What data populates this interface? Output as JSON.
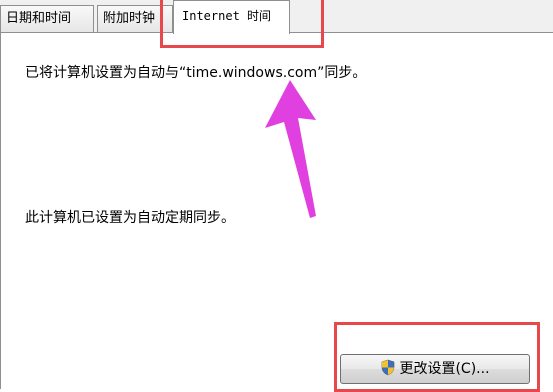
{
  "tabs": [
    {
      "label": "日期和时间"
    },
    {
      "label": "附加时钟"
    },
    {
      "label": "Internet 时间"
    }
  ],
  "content": {
    "sync_status": "已将计算机设置为自动与“time.windows.com”同步。",
    "schedule_status": "此计算机已设置为自动定期同步。"
  },
  "button": {
    "label": "更改设置(C)...",
    "icon": "uac-shield-icon"
  },
  "annotation": {
    "highlight_color": "#e8474b",
    "arrow_color": "#e040e0"
  }
}
